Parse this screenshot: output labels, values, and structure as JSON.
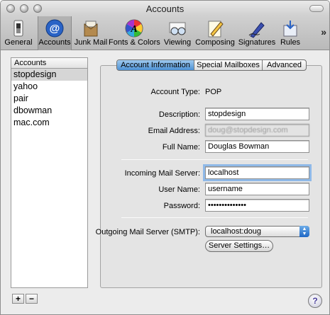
{
  "window": {
    "title": "Accounts"
  },
  "toolbar": {
    "items": [
      {
        "label": "General",
        "icon": "switch-icon"
      },
      {
        "label": "Accounts",
        "icon": "at-icon"
      },
      {
        "label": "Junk Mail",
        "icon": "junk-mail-icon"
      },
      {
        "label": "Fonts & Colors",
        "icon": "color-palette-icon"
      },
      {
        "label": "Viewing",
        "icon": "glasses-icon"
      },
      {
        "label": "Composing",
        "icon": "pencil-paper-icon"
      },
      {
        "label": "Signatures",
        "icon": "pen-icon"
      },
      {
        "label": "Rules",
        "icon": "rules-icon"
      }
    ],
    "overflow": "»",
    "selected": "Accounts"
  },
  "accounts_list": {
    "header": "Accounts",
    "items": [
      "stopdesign",
      "yahoo",
      "pair",
      "dbowman",
      "mac.com"
    ],
    "selected": "stopdesign",
    "add_label": "+",
    "remove_label": "−"
  },
  "tabs": [
    "Account Information",
    "Special Mailboxes",
    "Advanced"
  ],
  "active_tab": "Account Information",
  "form": {
    "account_type_label": "Account Type:",
    "account_type_value": "POP",
    "description_label": "Description:",
    "description_value": "stopdesign",
    "email_label": "Email Address:",
    "email_value": "doug@stopdesign.com",
    "fullname_label": "Full Name:",
    "fullname_value": "Douglas Bowman",
    "incoming_label": "Incoming Mail Server:",
    "incoming_value": "localhost",
    "username_label": "User Name:",
    "username_value": "username",
    "password_label": "Password:",
    "password_value": "••••••••••••••",
    "smtp_label": "Outgoing Mail Server (SMTP):",
    "smtp_value": "localhost:doug",
    "server_settings_label": "Server Settings…"
  },
  "help_label": "?",
  "colors": {
    "selected_tab": "#4e92d6",
    "focus_ring": "#8fb9e8",
    "list_selection": "#d6d6d6"
  }
}
